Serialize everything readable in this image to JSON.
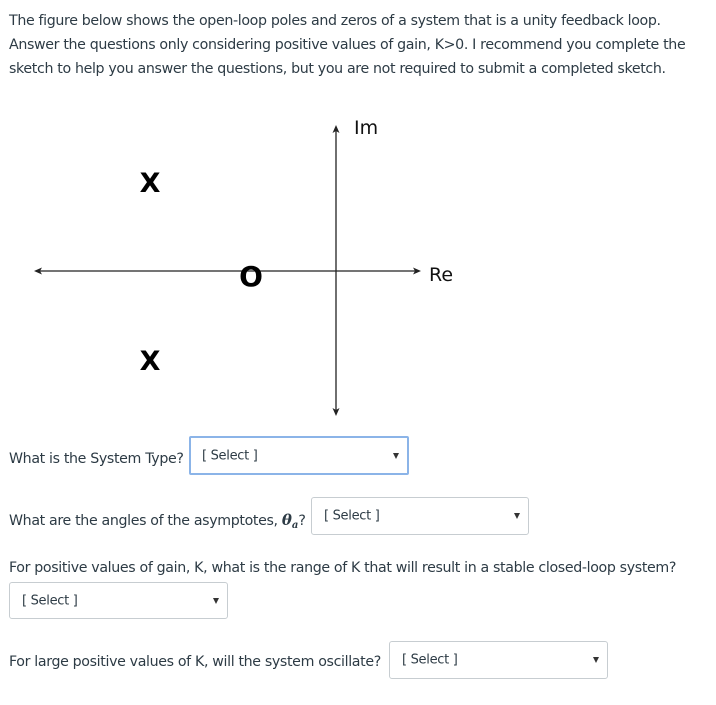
{
  "intro": {
    "lines": [
      "The figure below shows the open-loop poles and zeros of a system that is a unity feedback loop.",
      "Answer the questions only considering positive values of gain, K>0.  I recommend you complete the",
      "sketch to help you answer the questions, but you are not required to submit a completed sketch."
    ]
  },
  "figure": {
    "real_axis_label": "Re",
    "imag_axis_label": "Im",
    "pole_symbol": "X",
    "zero_symbol": "O",
    "poles": [
      {
        "position": "left-half-plane upper",
        "symbol": "X"
      },
      {
        "position": "left-half-plane lower",
        "symbol": "X"
      }
    ],
    "zeros": [
      {
        "position": "negative real axis",
        "symbol": "O"
      }
    ]
  },
  "questions": [
    {
      "label": "What is the System Type?",
      "select": {
        "value": "[ Select ]",
        "focused": true
      }
    },
    {
      "label_prefix": "What are the angles of the asymptotes, ",
      "label_symbol": "θ",
      "label_symbol_sub": "a",
      "label_suffix": "?",
      "select": {
        "value": "[ Select ]",
        "focused": false
      }
    },
    {
      "label": "For positive values of gain, K, what is the range of K that will result in a stable closed-loop system?",
      "select": {
        "value": "[ Select ]",
        "focused": false
      }
    },
    {
      "label": "For large positive values of K, will the system oscillate?",
      "select": {
        "value": "[ Select ]",
        "focused": false
      }
    }
  ],
  "colors": {
    "text": "#2d3b45",
    "select_border": "#c7cdd1",
    "select_focus_border": "#8bb4e8"
  }
}
